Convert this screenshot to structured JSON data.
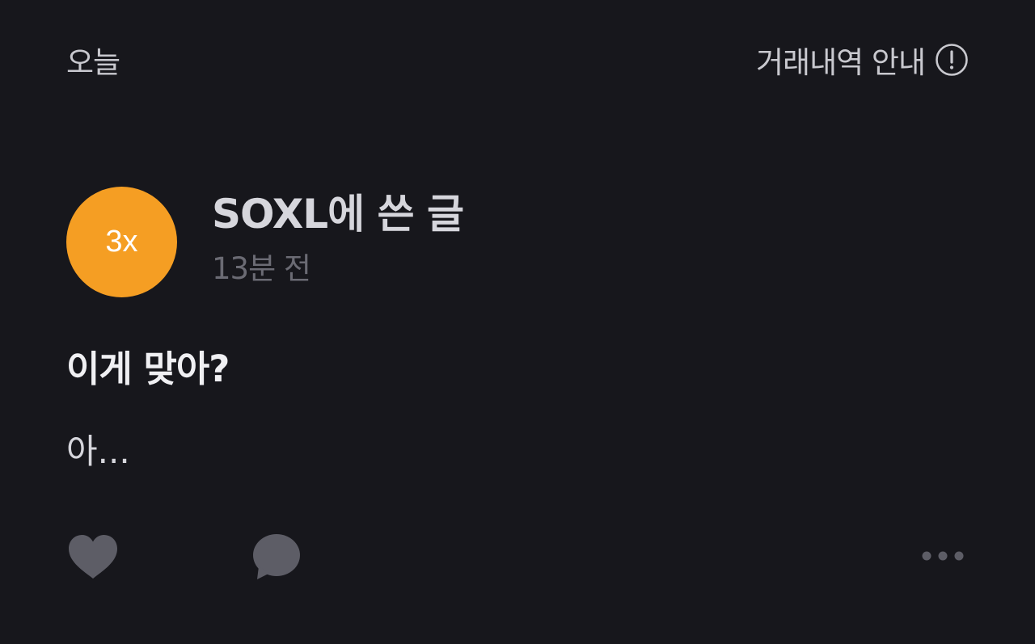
{
  "header": {
    "date_label": "오늘",
    "guide_label": "거래내역 안내",
    "guide_icon": "info-circle-icon"
  },
  "post": {
    "avatar_text": "3x",
    "avatar_color": "#f59e23",
    "author_title": "SOXL에 쓴 글",
    "time_ago": "13분 전",
    "title": "이게 맞아?",
    "body": "아..."
  },
  "actions": {
    "like_icon": "heart-icon",
    "comment_icon": "speech-bubble-icon",
    "more_icon": "more-horizontal-icon"
  }
}
